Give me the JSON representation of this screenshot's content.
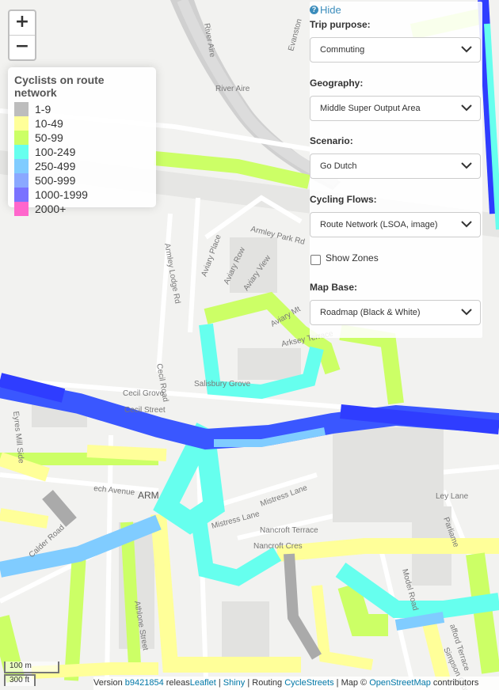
{
  "zoom": {
    "in_label": "+",
    "out_label": "−"
  },
  "legend": {
    "title": "Cyclists on route network",
    "items": [
      {
        "label": "1-9",
        "color": "#bdbdbd"
      },
      {
        "label": "10-49",
        "color": "#ffff99"
      },
      {
        "label": "50-99",
        "color": "#ccff66"
      },
      {
        "label": "100-249",
        "color": "#66ffee"
      },
      {
        "label": "250-499",
        "color": "#80ccff"
      },
      {
        "label": "500-999",
        "color": "#8aa8ff"
      },
      {
        "label": "1000-1999",
        "color": "#7a72ff"
      },
      {
        "label": "2000+",
        "color": "#ff66cc"
      }
    ]
  },
  "panel": {
    "hide_label": "Hide",
    "trip_purpose": {
      "label": "Trip purpose:",
      "value": "Commuting"
    },
    "geography": {
      "label": "Geography:",
      "value": "Middle Super Output Area"
    },
    "scenario": {
      "label": "Scenario:",
      "value": "Go Dutch"
    },
    "cycling_flows": {
      "label": "Cycling Flows:",
      "value": "Route Network (LSOA, image)"
    },
    "show_zones": {
      "label": "Show Zones",
      "checked": false
    },
    "map_base": {
      "label": "Map Base:",
      "value": "Roadmap (Black & White)"
    }
  },
  "map_labels": {
    "river_aire_1": "River Aire",
    "river_aire_2": "River Aire",
    "evanston": "Evanston",
    "armley_park_rd": "Armley Park Rd",
    "armley_lodge_rd": "Armley Lodge Rd",
    "aviary_place": "Aviary Place",
    "aviary_row": "Aviary Row",
    "aviary_view": "Aviary View",
    "aviary_mt": "Aviary Mt",
    "arksey_terrace": "Arksey Terrace",
    "cecil_grove": "Cecil Grove",
    "cecil_street": "Cecil Street",
    "cecil_road": "Cecil Road",
    "salisbury_grove": "Salisbury Grove",
    "eyres_mill_side": "Eyres Mill Side",
    "beech_avenue": "ech Avenue",
    "armley": "ARM",
    "mistress_lane_1": "Mistress Lane",
    "mistress_lane_2": "Mistress Lane",
    "nancroft_terrace": "Nancroft Terrace",
    "nancroft_cres": "Nancroft Cres",
    "calder_road": "Calder Road",
    "athlone_street": "Athlone Street",
    "ley_lane": "Ley Lane",
    "model_road": "Model Road",
    "stafford_terrace": "afford Terrace",
    "simpson_grove": "Simpson Grove",
    "parliament": "Parliame"
  },
  "scale": {
    "metric": "100 m",
    "imperial": "300 ft"
  },
  "attribution": {
    "version_prefix": "Version ",
    "version_link": "b9421854",
    "released": " releas",
    "leaflet": "Leaflet",
    "sep1": " | ",
    "shiny": "Shiny",
    "routing_prefix": " | Routing ",
    "cyclestreets": "CycleStreets",
    "map_prefix": " | Map © ",
    "osm": "OpenStreetMap",
    "suffix": " contributors"
  }
}
